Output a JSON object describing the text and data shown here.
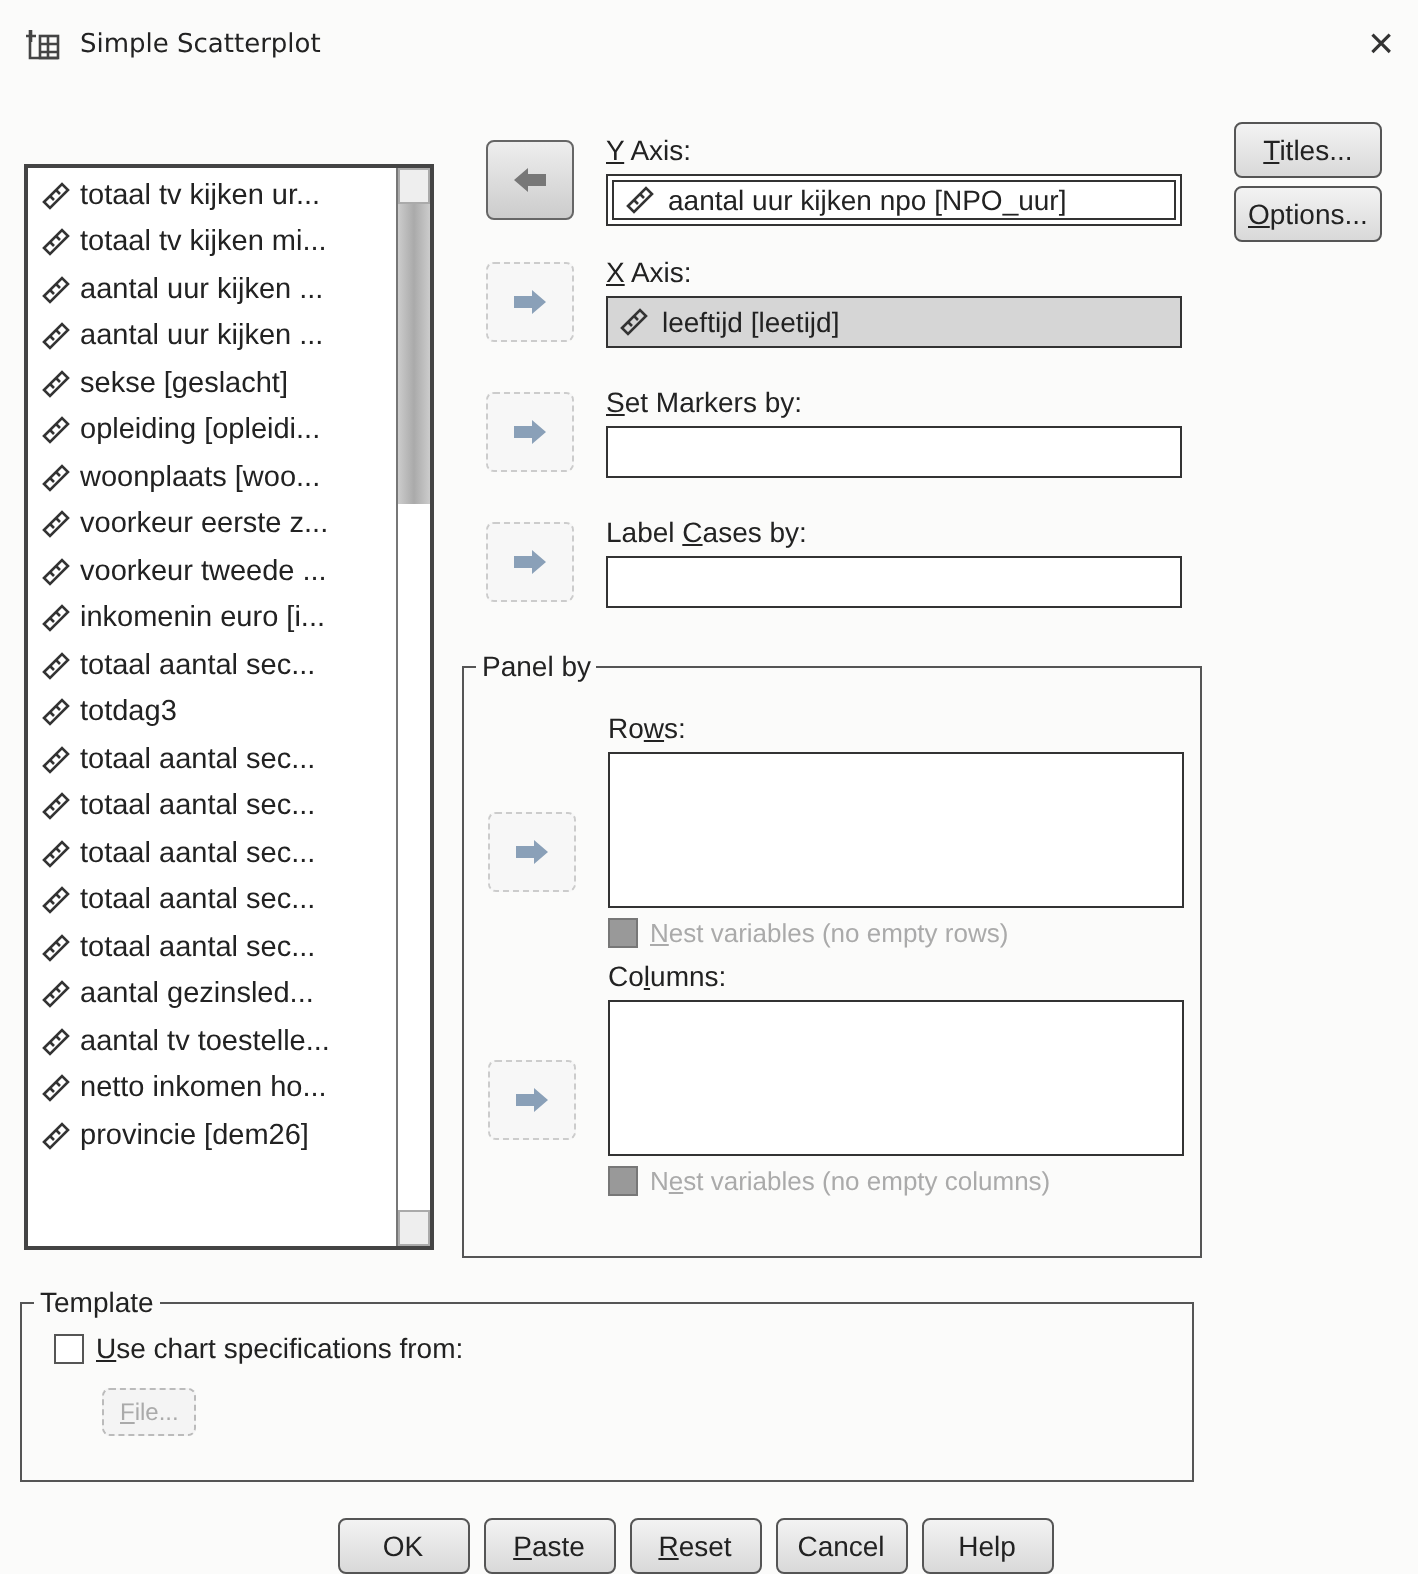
{
  "window": {
    "title": "Simple Scatterplot",
    "close": "×"
  },
  "variables": [
    {
      "name": "totaal tv kijken ur..."
    },
    {
      "name": "totaal tv kijken mi..."
    },
    {
      "name": "aantal uur kijken ..."
    },
    {
      "name": "aantal uur kijken ..."
    },
    {
      "name": "sekse [geslacht]"
    },
    {
      "name": "opleiding [opleidi..."
    },
    {
      "name": "woonplaats [woo..."
    },
    {
      "name": "voorkeur eerste z..."
    },
    {
      "name": "voorkeur tweede ..."
    },
    {
      "name": "inkomenin euro [i..."
    },
    {
      "name": "totaal aantal sec..."
    },
    {
      "name": "totdag3"
    },
    {
      "name": "totaal aantal sec..."
    },
    {
      "name": "totaal aantal sec..."
    },
    {
      "name": "totaal aantal sec..."
    },
    {
      "name": "totaal aantal sec..."
    },
    {
      "name": "totaal aantal sec..."
    },
    {
      "name": "aantal gezinsled..."
    },
    {
      "name": "aantal tv toestelle..."
    },
    {
      "name": "netto inkomen ho..."
    },
    {
      "name": "provincie [dem26]"
    }
  ],
  "targets": [
    {
      "label": {
        "key": "Y",
        "post": " Axis:"
      },
      "value": "aantal uur kijken npo [NPO_uur]",
      "arrow_enabled": true,
      "focused": true,
      "selected": false
    },
    {
      "label": {
        "key": "X",
        "post": " Axis:"
      },
      "value": "leeftijd [leetijd]",
      "arrow_enabled": false,
      "focused": false,
      "selected": true
    },
    {
      "label": {
        "key": "S",
        "post": "et Markers by:"
      },
      "arrow_enabled": false,
      "focused": false,
      "selected": false
    },
    {
      "label": {
        "pre": "Label ",
        "key": "C",
        "post": "ases by:"
      },
      "arrow_enabled": false,
      "focused": false,
      "selected": false
    }
  ],
  "panel_by": {
    "title": "Panel by",
    "lists": [
      {
        "label": {
          "pre": "Ro",
          "key": "w",
          "post": "s:"
        },
        "arrow_enabled": false,
        "nest": {
          "label": {
            "key": "N",
            "post": "est variables (no empty rows)"
          },
          "checked": false,
          "disabled": true
        }
      },
      {
        "label": {
          "pre": "Co",
          "key": "l",
          "post": "umns:"
        },
        "arrow_enabled": false,
        "nest": {
          "label": {
            "pre": "N",
            "key": "e",
            "post": "st variables (no empty columns)"
          },
          "checked": false,
          "disabled": true
        }
      }
    ]
  },
  "side_buttons": [
    {
      "label": {
        "key": "T",
        "post": "itles..."
      }
    },
    {
      "label": {
        "key": "O",
        "post": "ptions..."
      }
    }
  ],
  "template": {
    "title": "Template",
    "checkbox": {
      "label": {
        "key": "U",
        "post": "se chart specifications from:"
      },
      "checked": false
    },
    "file_button": {
      "label": {
        "key": "F",
        "post": "ile..."
      },
      "disabled": true
    }
  },
  "buttons": [
    {
      "label": {
        "pre": "OK"
      }
    },
    {
      "label": {
        "key": "P",
        "post": "aste"
      }
    },
    {
      "label": {
        "key": "R",
        "post": "eset"
      }
    },
    {
      "label": {
        "pre": "Cancel"
      }
    },
    {
      "label": {
        "pre": "Help"
      }
    }
  ]
}
